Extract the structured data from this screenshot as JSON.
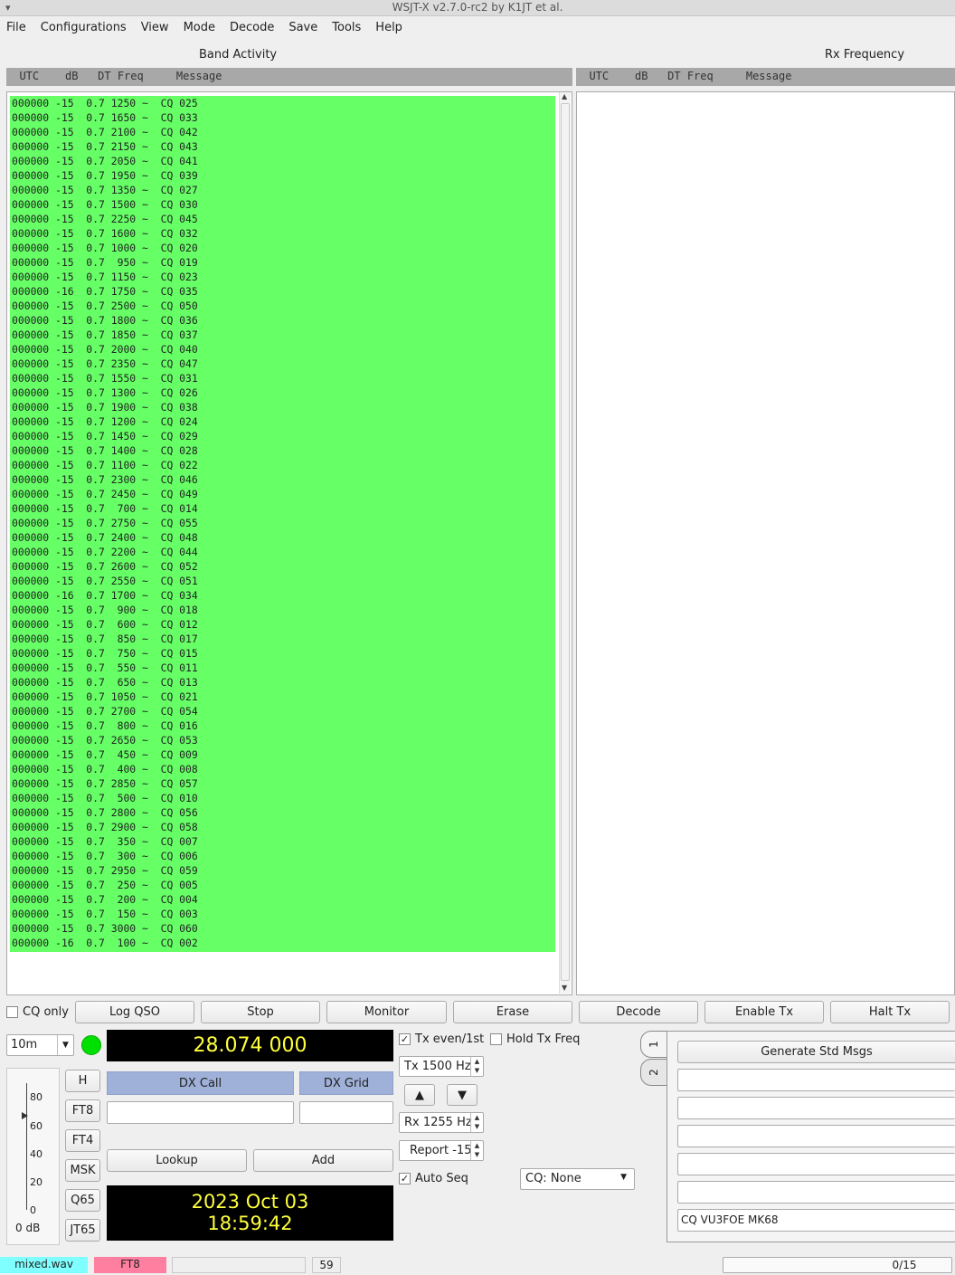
{
  "window": {
    "title": "WSJT-X   v2.7.0-rc2   by K1JT et al."
  },
  "menu": [
    "File",
    "Configurations",
    "View",
    "Mode",
    "Decode",
    "Save",
    "Tools",
    "Help"
  ],
  "band_activity": {
    "title": "Band Activity",
    "header": "  UTC    dB   DT Freq     Message",
    "rows": [
      "000000 -15  0.7 1250 ~  CQ 025",
      "000000 -15  0.7 1650 ~  CQ 033",
      "000000 -15  0.7 2100 ~  CQ 042",
      "000000 -15  0.7 2150 ~  CQ 043",
      "000000 -15  0.7 2050 ~  CQ 041",
      "000000 -15  0.7 1950 ~  CQ 039",
      "000000 -15  0.7 1350 ~  CQ 027",
      "000000 -15  0.7 1500 ~  CQ 030",
      "000000 -15  0.7 2250 ~  CQ 045",
      "000000 -15  0.7 1600 ~  CQ 032",
      "000000 -15  0.7 1000 ~  CQ 020",
      "000000 -15  0.7  950 ~  CQ 019",
      "000000 -15  0.7 1150 ~  CQ 023",
      "000000 -16  0.7 1750 ~  CQ 035",
      "000000 -15  0.7 2500 ~  CQ 050",
      "000000 -15  0.7 1800 ~  CQ 036",
      "000000 -15  0.7 1850 ~  CQ 037",
      "000000 -15  0.7 2000 ~  CQ 040",
      "000000 -15  0.7 2350 ~  CQ 047",
      "000000 -15  0.7 1550 ~  CQ 031",
      "000000 -15  0.7 1300 ~  CQ 026",
      "000000 -15  0.7 1900 ~  CQ 038",
      "000000 -15  0.7 1200 ~  CQ 024",
      "000000 -15  0.7 1450 ~  CQ 029",
      "000000 -15  0.7 1400 ~  CQ 028",
      "000000 -15  0.7 1100 ~  CQ 022",
      "000000 -15  0.7 2300 ~  CQ 046",
      "000000 -15  0.7 2450 ~  CQ 049",
      "000000 -15  0.7  700 ~  CQ 014",
      "000000 -15  0.7 2750 ~  CQ 055",
      "000000 -15  0.7 2400 ~  CQ 048",
      "000000 -15  0.7 2200 ~  CQ 044",
      "000000 -15  0.7 2600 ~  CQ 052",
      "000000 -15  0.7 2550 ~  CQ 051",
      "000000 -16  0.7 1700 ~  CQ 034",
      "000000 -15  0.7  900 ~  CQ 018",
      "000000 -15  0.7  600 ~  CQ 012",
      "000000 -15  0.7  850 ~  CQ 017",
      "000000 -15  0.7  750 ~  CQ 015",
      "000000 -15  0.7  550 ~  CQ 011",
      "000000 -15  0.7  650 ~  CQ 013",
      "000000 -15  0.7 1050 ~  CQ 021",
      "000000 -15  0.7 2700 ~  CQ 054",
      "000000 -15  0.7  800 ~  CQ 016",
      "000000 -15  0.7 2650 ~  CQ 053",
      "000000 -15  0.7  450 ~  CQ 009",
      "000000 -15  0.7  400 ~  CQ 008",
      "000000 -15  0.7 2850 ~  CQ 057",
      "000000 -15  0.7  500 ~  CQ 010",
      "000000 -15  0.7 2800 ~  CQ 056",
      "000000 -15  0.7 2900 ~  CQ 058",
      "000000 -15  0.7  350 ~  CQ 007",
      "000000 -15  0.7  300 ~  CQ 006",
      "000000 -15  0.7 2950 ~  CQ 059",
      "000000 -15  0.7  250 ~  CQ 005",
      "000000 -15  0.7  200 ~  CQ 004",
      "000000 -15  0.7  150 ~  CQ 003",
      "000000 -15  0.7 3000 ~  CQ 060",
      "000000 -16  0.7  100 ~  CQ 002"
    ]
  },
  "rx_frequency": {
    "title": "Rx Frequency",
    "header": "  UTC    dB   DT Freq     Message"
  },
  "controls": {
    "cq_only": "CQ only",
    "log_qso": "Log QSO",
    "stop": "Stop",
    "monitor": "Monitor",
    "erase": "Erase",
    "decode": "Decode",
    "enable_tx": "Enable Tx",
    "halt_tx": "Halt Tx"
  },
  "band": "10m",
  "dial_frequency": "28.074 000",
  "mode_buttons": [
    "H",
    "FT8",
    "FT4",
    "MSK",
    "Q65",
    "JT65"
  ],
  "dx": {
    "call_label": "DX Call",
    "grid_label": "DX Grid",
    "lookup": "Lookup",
    "add": "Add"
  },
  "datetime": {
    "date": "2023 Oct 03",
    "time": "18:59:42"
  },
  "meter": {
    "ticks": [
      "80",
      "60",
      "40",
      "20",
      "0"
    ],
    "level_label": "0 dB"
  },
  "tx_panel": {
    "tx_even": "Tx even/1st",
    "hold_tx_freq": "Hold Tx Freq",
    "tx_freq": "Tx  1500  Hz",
    "rx_freq": "Rx  1255  Hz",
    "report": "Report -15",
    "auto_seq": "Auto Seq",
    "cq_select": "CQ: None",
    "up_arrow": "▲",
    "down_arrow": "▼"
  },
  "msgs": {
    "tab1": "1",
    "tab2": "2",
    "generate": "Generate Std Msgs",
    "msg6": "CQ VU3FOE MK68"
  },
  "statusbar": {
    "file": "mixed.wav",
    "mode": "FT8",
    "count": "59",
    "progress": "0/15"
  },
  "colors": {
    "decode_bg": "#66ff66",
    "lcd_text": "#ffff3c",
    "file_badge": "#7fffff",
    "mode_badge": "#ff7fa0"
  }
}
